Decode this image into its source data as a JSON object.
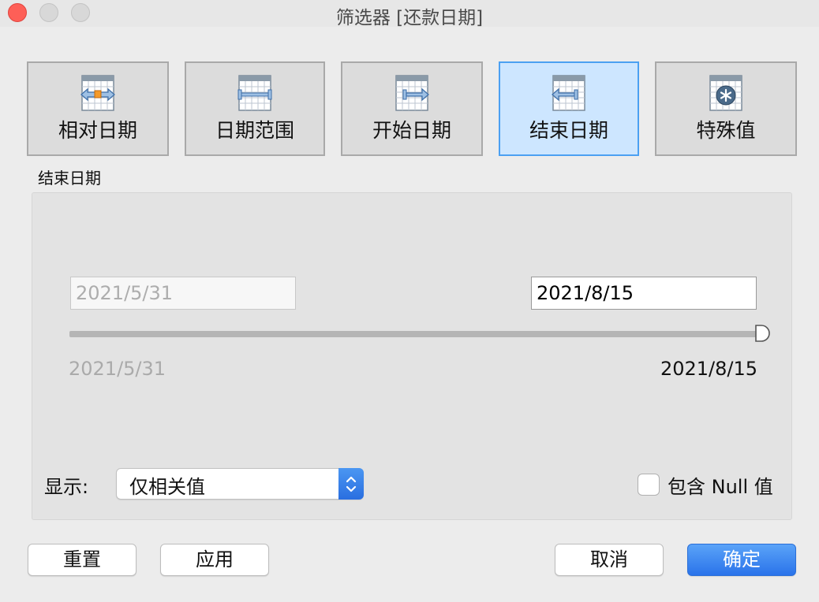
{
  "window": {
    "title": "筛选器 [还款日期]"
  },
  "modes": [
    {
      "label": "相对日期",
      "icon": "relative-date-icon"
    },
    {
      "label": "日期范围",
      "icon": "date-range-icon"
    },
    {
      "label": "开始日期",
      "icon": "start-date-icon"
    },
    {
      "label": "结束日期",
      "icon": "end-date-icon",
      "active": true
    },
    {
      "label": "特殊值",
      "icon": "special-value-icon"
    }
  ],
  "section": {
    "title": "结束日期"
  },
  "range": {
    "start_input": "2021/5/31",
    "end_input": "2021/8/15",
    "min_label": "2021/5/31",
    "max_label": "2021/8/15",
    "slider_position": 1.0
  },
  "show": {
    "label": "显示:",
    "selected": "仅相关值"
  },
  "include_null": {
    "label": "包含 Null 值",
    "checked": false
  },
  "buttons": {
    "reset": "重置",
    "apply": "应用",
    "cancel": "取消",
    "ok": "确定"
  },
  "colors": {
    "active_bg": "#cde6ff",
    "active_border": "#4ba0f2",
    "primary": "#2a73ea"
  }
}
